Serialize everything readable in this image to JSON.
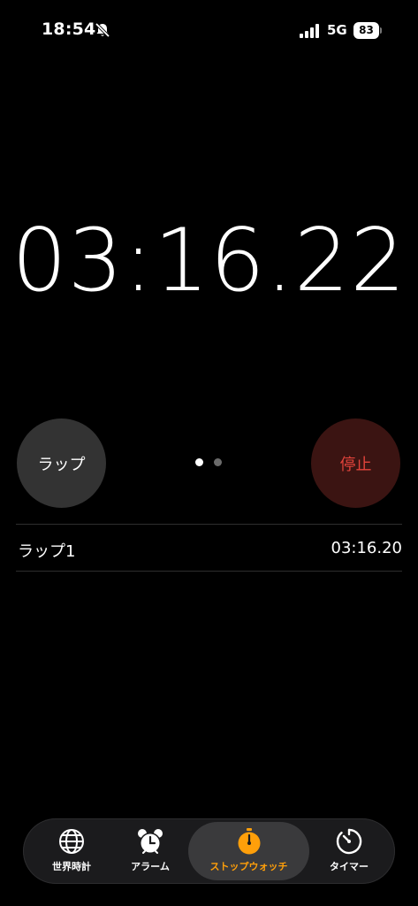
{
  "status_bar": {
    "time": "18:54",
    "network": "5G",
    "battery": "83"
  },
  "stopwatch": {
    "elapsed": "03:16.22"
  },
  "controls": {
    "lap_label": "ラップ",
    "stop_label": "停止"
  },
  "laps": [
    {
      "name": "ラップ1",
      "time": "03:16.20"
    }
  ],
  "tabs": [
    {
      "label": "世界時計",
      "icon": "globe-icon",
      "active": false
    },
    {
      "label": "アラーム",
      "icon": "alarm-clock-icon",
      "active": false
    },
    {
      "label": "ストップウォッチ",
      "icon": "stopwatch-icon",
      "active": true
    },
    {
      "label": "タイマー",
      "icon": "timer-icon",
      "active": false
    }
  ],
  "colors": {
    "background": "#000000",
    "accent": "#ff9f0a",
    "stop_text": "#e2433b",
    "stop_bg": "#3b1412",
    "lap_bg": "#333333"
  }
}
